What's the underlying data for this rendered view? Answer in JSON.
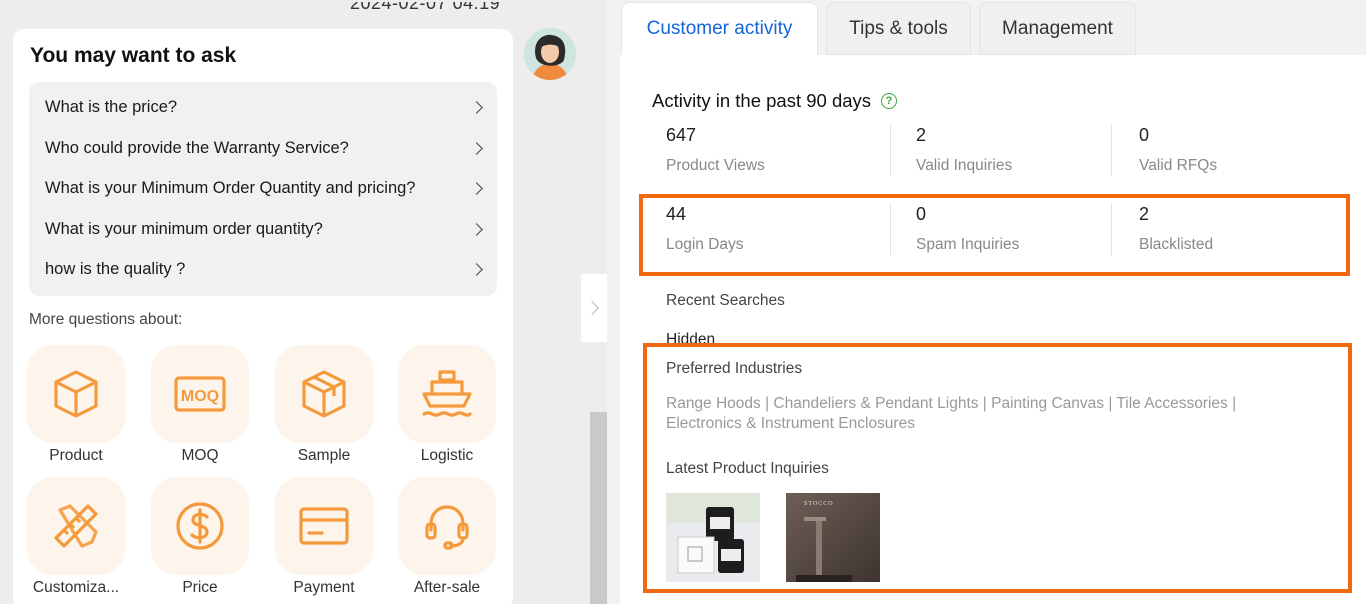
{
  "chat": {
    "timestamp": "2024-02-07 04:19",
    "ask_title": "You may want to ask",
    "questions": [
      "What is the price?",
      "Who could provide the Warranty Service?",
      "What is your Minimum Order Quantity and pricing?",
      "What is your minimum order quantity?",
      "how is the quality ?"
    ],
    "more_label": "More questions about:",
    "categories": [
      {
        "label": "Product",
        "icon": "cube-icon"
      },
      {
        "label": "MOQ",
        "icon": "moq-icon"
      },
      {
        "label": "Sample",
        "icon": "box-icon"
      },
      {
        "label": "Logistic",
        "icon": "ship-icon"
      },
      {
        "label": "Customiza...",
        "icon": "ruler-pencil-icon"
      },
      {
        "label": "Price",
        "icon": "dollar-icon"
      },
      {
        "label": "Payment",
        "icon": "card-icon"
      },
      {
        "label": "After-sale",
        "icon": "headset-icon"
      }
    ],
    "moq_icon_text": "MOQ"
  },
  "tabs": [
    "Customer activity",
    "Tips & tools",
    "Management"
  ],
  "activity": {
    "title": "Activity in the past 90 days",
    "help_glyph": "?",
    "stats": [
      {
        "value": "647",
        "label": "Product Views"
      },
      {
        "value": "2",
        "label": "Valid Inquiries"
      },
      {
        "value": "0",
        "label": "Valid RFQs"
      },
      {
        "value": "44",
        "label": "Login Days"
      },
      {
        "value": "0",
        "label": "Spam Inquiries"
      },
      {
        "value": "2",
        "label": "Blacklisted"
      }
    ],
    "recent_searches_label": "Recent Searches",
    "recent_searches_value": "Hidden",
    "preferred_industries_label": "Preferred Industries",
    "preferred_industries": "Range Hoods | Chandeliers & Pendant Lights | Painting Canvas | Tile Accessories | Electronics & Instrument Enclosures",
    "latest_inquiries_label": "Latest Product Inquiries",
    "thumb_brand": "STOCCO"
  },
  "colors": {
    "accent": "#1565d8",
    "highlight": "#f26a10",
    "icon": "#f59a3c"
  }
}
